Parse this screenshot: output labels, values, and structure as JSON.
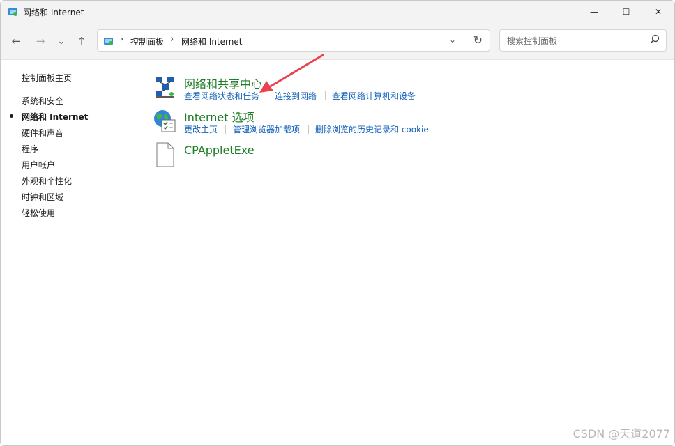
{
  "window": {
    "title": "网络和 Internet",
    "minimize_glyph": "—",
    "maximize_glyph": "☐",
    "close_glyph": "✕"
  },
  "nav": {
    "back_glyph": "←",
    "forward_glyph": "→",
    "recent_glyph": "⌄",
    "up_glyph": "↑"
  },
  "address": {
    "crumbs": [
      "控制面板",
      "网络和 Internet"
    ],
    "separator": "›",
    "dropdown_glyph": "⌄",
    "refresh_glyph": "↻"
  },
  "search": {
    "placeholder": "搜索控制面板"
  },
  "sidebar": {
    "items": [
      {
        "label": "控制面板主页"
      },
      {
        "label": "系统和安全"
      },
      {
        "label": "网络和 Internet",
        "active": true
      },
      {
        "label": "硬件和声音"
      },
      {
        "label": "程序"
      },
      {
        "label": "用户帐户"
      },
      {
        "label": "外观和个性化"
      },
      {
        "label": "时钟和区域"
      },
      {
        "label": "轻松使用"
      }
    ]
  },
  "categories": [
    {
      "title": "网络和共享中心",
      "icon": "network-sharing-center-icon",
      "links": [
        "查看网络状态和任务",
        "连接到网络",
        "查看网络计算机和设备"
      ]
    },
    {
      "title": "Internet 选项",
      "icon": "internet-options-icon",
      "links": [
        "更改主页",
        "管理浏览器加载项",
        "删除浏览的历史记录和 cookie"
      ]
    },
    {
      "title": "CPAppletExe",
      "icon": "blank-file-icon",
      "links": []
    }
  ],
  "colors": {
    "category_title": "#1e7d26",
    "link": "#0f5fb8",
    "annotation_arrow": "#e8434e"
  },
  "watermark": "CSDN @天道2077"
}
